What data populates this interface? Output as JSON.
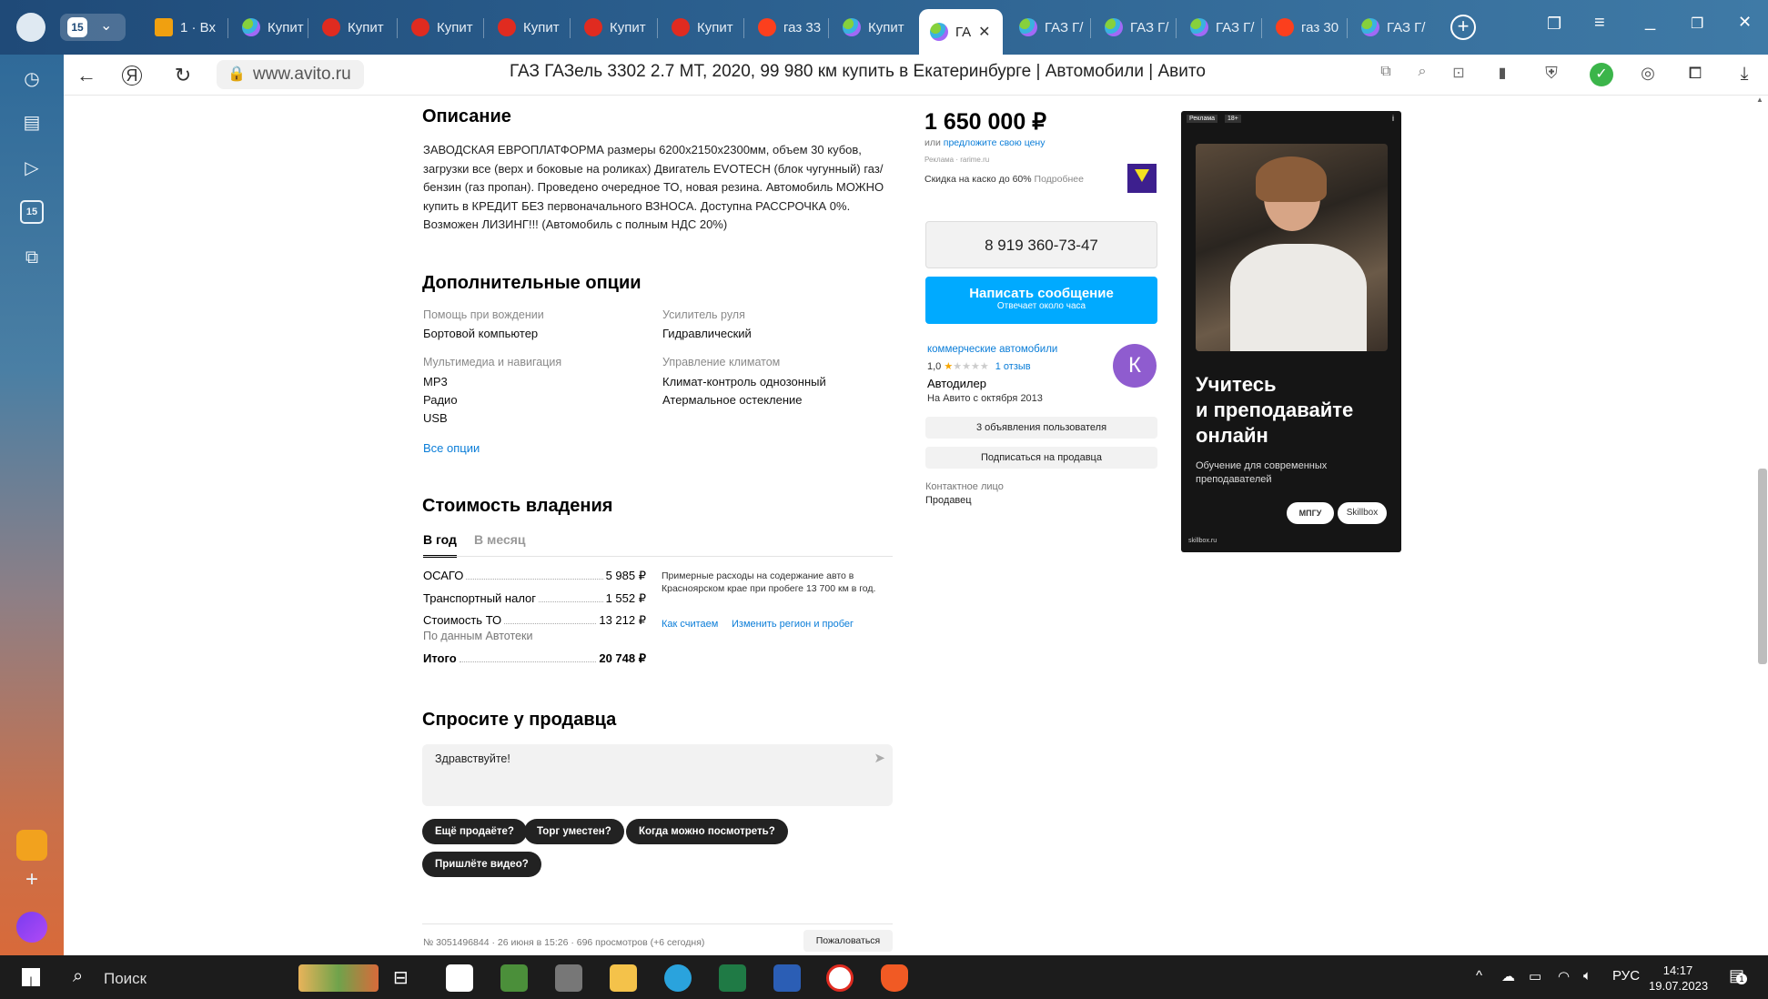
{
  "browser": {
    "tab_count_badge": "15",
    "tabs": [
      {
        "label": "1 · Вх",
        "icon": "mail-icon"
      },
      {
        "label": "Купит",
        "icon": "avito-icon"
      },
      {
        "label": "Купит",
        "icon": "drom-icon"
      },
      {
        "label": "Купит",
        "icon": "drom-icon"
      },
      {
        "label": "Купит",
        "icon": "drom-icon"
      },
      {
        "label": "Купит",
        "icon": "drom-icon"
      },
      {
        "label": "Купит",
        "icon": "drom-icon"
      },
      {
        "label": "газ 33",
        "icon": "yandex-icon"
      },
      {
        "label": "Купит",
        "icon": "avito-icon"
      },
      {
        "label": "ГА",
        "icon": "avito-icon",
        "active": true
      },
      {
        "label": "ГАЗ Г/",
        "icon": "avito-icon"
      },
      {
        "label": "ГАЗ Г/",
        "icon": "avito-icon"
      },
      {
        "label": "ГАЗ Г/",
        "icon": "avito-icon"
      },
      {
        "label": "газ 30",
        "icon": "yandex-icon"
      },
      {
        "label": "ГАЗ Г/",
        "icon": "avito-icon"
      }
    ],
    "url": "www.avito.ru",
    "page_title": "ГАЗ ГАЗель 3302 2.7 MT, 2020, 99 980 км купить в Екатеринбурге | Автомобили | Авито",
    "sidebar_badge": "15"
  },
  "listing": {
    "description_heading": "Описание",
    "description_lines": [
      "ЗАВОДСКАЯ ЕВРОПЛАТФОРМА размеры 6200х2150х2300мм, объем 30 кубов,",
      "загрузки все (верх и боковые на роликах) Двигатель EVOTECH (блок чугунный) газ/",
      "бензин (газ пропан). Проведено очередное ТО, новая резина. Автомобиль МОЖНО",
      "купить в КРЕДИТ БЕЗ первоначального ВЗНОСА. Доступна РАССРОЧКА 0%.",
      "Возможен ЛИЗИНГ!!! (Автомобиль с полным НДС 20%)"
    ],
    "options_heading": "Дополнительные опции",
    "options": {
      "driving_help_label": "Помощь при вождении",
      "driving_help_value": "Бортовой компьютер",
      "steering_label": "Усилитель руля",
      "steering_value": "Гидравлический",
      "multimedia_label": "Мультимедиа и навигация",
      "multimedia_values": [
        "MP3",
        "Радио",
        "USB"
      ],
      "climate_label": "Управление климатом",
      "climate_values": [
        "Климат-контроль однозонный",
        "Атермальное остекление"
      ],
      "all_options_link": "Все опции"
    },
    "ownership_heading": "Стоимость владения",
    "ownership_tabs": [
      "В год",
      "В месяц"
    ],
    "costs": [
      {
        "label": "ОСАГО",
        "amount": "5 985 ₽"
      },
      {
        "label": "Транспортный налог",
        "amount": "1 552 ₽"
      },
      {
        "label": "Стоимость ТО",
        "amount": "13 212 ₽"
      }
    ],
    "costs_source": "По данным Автотеки",
    "total_label": "Итого",
    "total_amount": "20 748 ₽",
    "costs_note": "Примерные расходы на содержание авто в Красноярском крае при пробеге 13 700 км в год.",
    "how_we_count": "Как считаем",
    "change_region": "Изменить регион и пробег",
    "ask_heading": "Спросите у продавца",
    "message_value": "Здравствуйте!",
    "quick_questions": [
      "Ещё продаёте?",
      "Торг уместен?",
      "Когда можно посмотреть?",
      "Пришлёте видео?"
    ],
    "footer_meta": "№ 3051496844 · 26 июня в 15:26 · 696 просмотров (+6 сегодня)",
    "report_button": "Пожаловаться"
  },
  "seller_panel": {
    "price": "1 650 000 ₽",
    "price_offer_prefix": "или ",
    "price_offer_link": "предложите свою цену",
    "ad_label": "Реклама",
    "ad_domain": "rarime.ru",
    "kasko_text": "Скидка на каско до 60%",
    "kasko_more": "Подробнее",
    "phone": "8 919 360-73-47",
    "write_button": "Написать сообщение",
    "write_sub": "Отвечает около часа",
    "seller_name": "коммерческие автомобили",
    "rating": "1,0",
    "reviews": "1 отзыв",
    "seller_type": "Автодилер",
    "since": "На Авито с октября 2013",
    "avatar_letter": "К",
    "listings_button": "3 объявления пользователя",
    "subscribe_button": "Подписаться на продавца",
    "contact_label": "Контактное лицо",
    "contact_value": "Продавец"
  },
  "ad_banner": {
    "tag": "Реклама",
    "age": "18+",
    "headline_lines": [
      "Учитесь",
      "и преподавайте",
      "онлайн"
    ],
    "subtext": "Обучение для современных преподавателей",
    "logo1": "МПГУ",
    "logo2": "Skillbox",
    "domain": "skillbox.ru"
  },
  "taskbar": {
    "search_label": "Поиск",
    "lang": "РУС",
    "time": "14:17",
    "date": "19.07.2023",
    "notif_count": "1"
  },
  "colors": {
    "link": "#0a7dd8",
    "write_button": "#00aaff",
    "avatar": "#8f5ccf"
  }
}
